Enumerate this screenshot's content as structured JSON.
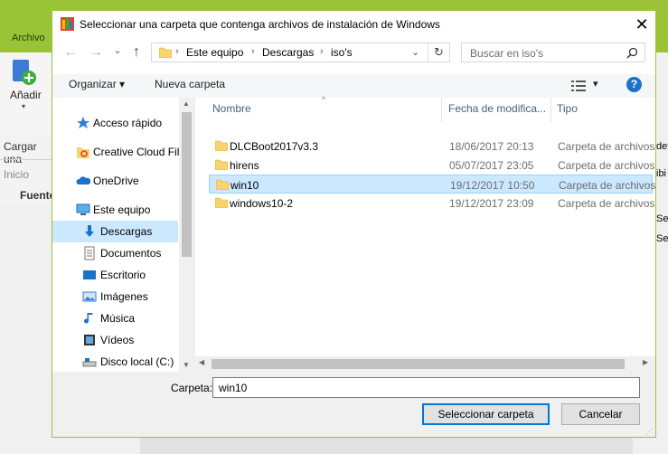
{
  "background_app": {
    "menu_label": "Archivo",
    "add_label": "Añadir",
    "left_items": [
      "Cargar una",
      "Inicio",
      "Fuente"
    ],
    "right_items": [
      "def",
      "ibi",
      "Ses",
      "Ses"
    ]
  },
  "dialog": {
    "title": "Seleccionar una carpeta que contenga archivos de instalación de Windows",
    "close_glyph": "✕",
    "nav": {
      "back": "←",
      "forward": "→",
      "history": "⌄",
      "up": "↑",
      "breadcrumb": [
        "Este equipo",
        "Descargas",
        "iso's"
      ],
      "separator": "›",
      "refresh": "↻",
      "search_placeholder": "Buscar en iso's"
    },
    "toolbar": {
      "organize": "Organizar ▾",
      "new_folder": "Nueva carpeta",
      "view": "▾",
      "help": "?"
    },
    "nav_pane": [
      {
        "label": "Acceso rápido",
        "icon": "star-icon"
      },
      {
        "label": "Creative Cloud Fil",
        "icon": "creative-cloud-icon"
      },
      {
        "label": "OneDrive",
        "icon": "cloud-icon"
      },
      {
        "label": "Este equipo",
        "icon": "computer-icon"
      },
      {
        "label": "Descargas",
        "icon": "download-icon",
        "selected": true
      },
      {
        "label": "Documentos",
        "icon": "document-icon"
      },
      {
        "label": "Escritorio",
        "icon": "desktop-icon"
      },
      {
        "label": "Imágenes",
        "icon": "pictures-icon"
      },
      {
        "label": "Música",
        "icon": "music-icon"
      },
      {
        "label": "Vídeos",
        "icon": "video-icon"
      },
      {
        "label": "Disco local (C:)",
        "icon": "drive-icon"
      }
    ],
    "columns": [
      "Nombre",
      "Fecha de modifica...",
      "Tipo"
    ],
    "files": [
      {
        "name": "DLCBoot2017v3.3",
        "date": "18/06/2017 20:13",
        "type": "Carpeta de archivos"
      },
      {
        "name": "hirens",
        "date": "05/07/2017 23:05",
        "type": "Carpeta de archivos"
      },
      {
        "name": "win10",
        "date": "19/12/2017 10:50",
        "type": "Carpeta de archivos",
        "selected": true
      },
      {
        "name": "windows10-2",
        "date": "19/12/2017 23:09",
        "type": "Carpeta de archivos"
      }
    ],
    "folder_label": "Carpeta:",
    "folder_value": "win10",
    "select_button": "Seleccionar carpeta",
    "cancel_button": "Cancelar",
    "colors": {
      "accent": "#9bc337",
      "selection": "#cce8ff",
      "primary_border": "#0078d7"
    }
  }
}
